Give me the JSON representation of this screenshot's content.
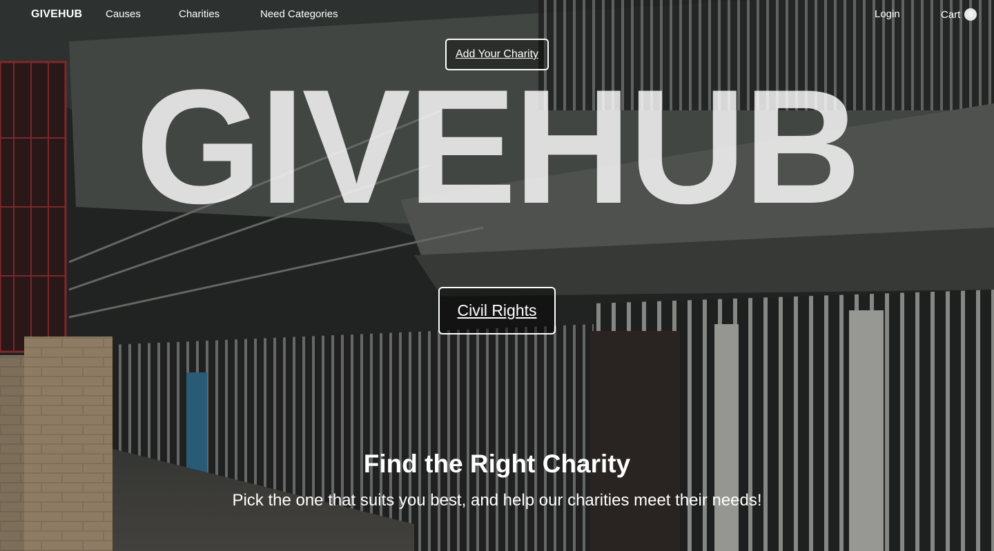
{
  "navbar": {
    "brand": "GIVEHUB",
    "links": [
      "Causes",
      "Charities",
      "Need Categories"
    ],
    "login_label": "Login",
    "cart_label": "Cart",
    "cart_count": "0"
  },
  "hero": {
    "add_charity_label": "Add Your Charity",
    "giant_title": "GIVEHUB",
    "category_button_label": "Civil Rights",
    "headline": "Find the Right Charity",
    "subheadline": "Pick the one that suits you best, and help our charities meet their needs!"
  },
  "colors": {
    "text": "#ffffff",
    "badge_bg": "#e8e8e8",
    "background_tint": "#2d302f"
  }
}
